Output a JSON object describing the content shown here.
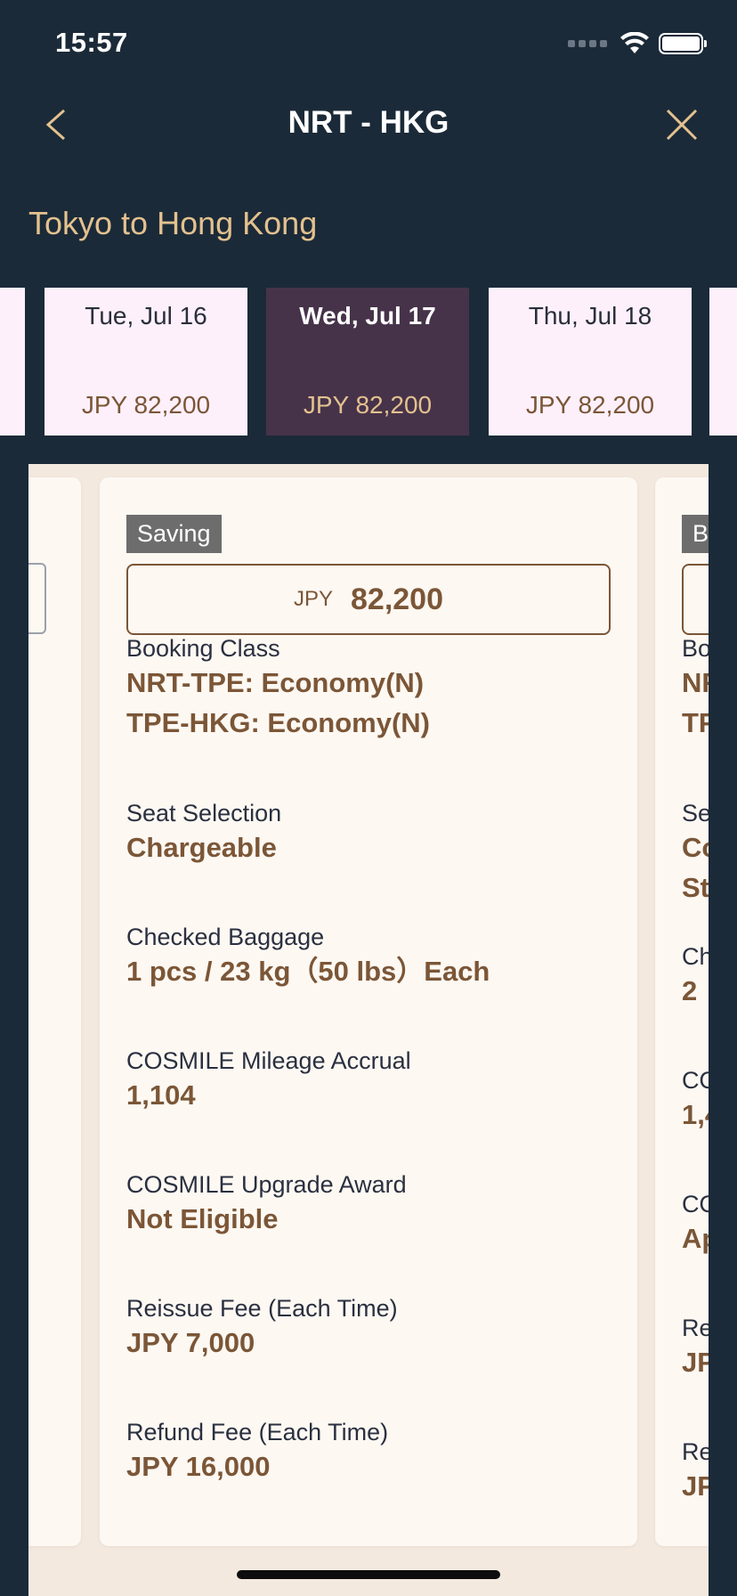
{
  "status_bar": {
    "time": "15:57"
  },
  "nav": {
    "title": "NRT - HKG"
  },
  "route_subtitle": "Tokyo to Hong Kong",
  "dates": [
    {
      "label": "Tue, Jul 16",
      "price": "JPY 82,200"
    },
    {
      "label": "Wed, Jul 17",
      "price": "JPY 82,200",
      "selected": true
    },
    {
      "label": "Thu, Jul 18",
      "price": "JPY 82,200"
    }
  ],
  "main_fare": {
    "tag": "Saving",
    "currency": "JPY",
    "amount": "82,200",
    "booking_class": {
      "label": "Booking Class",
      "line1": "NRT-TPE: Economy(N)",
      "line2": "TPE-HKG: Economy(N)"
    },
    "seat_selection": {
      "label": "Seat Selection",
      "value": "Chargeable"
    },
    "checked_baggage": {
      "label": "Checked Baggage",
      "value": "1 pcs / 23 kg（50 lbs）Each"
    },
    "mileage_accrual": {
      "label": "COSMILE Mileage Accrual",
      "value": "1,104"
    },
    "upgrade_award": {
      "label": "COSMILE Upgrade Award",
      "value": "Not Eligible"
    },
    "reissue_fee": {
      "label": "Reissue Fee (Each Time)",
      "value": "JPY 7,000"
    },
    "refund_fee": {
      "label": "Refund Fee (Each Time)",
      "value": "JPY 16,000"
    }
  },
  "right_fare_partial": {
    "tag": "B",
    "bo": "Bo",
    "nr": "NR",
    "tp": "TP",
    "se": "Se",
    "co": "Co",
    "st": "St",
    "ch": "Ch",
    "two": "2",
    "cm": "CO",
    "one4": "1,4",
    "cu": "CO",
    "ap": "Ap",
    "re": "Re",
    "jp": "JP",
    "re2": "Re",
    "jp2": "JP"
  },
  "colors": {
    "background": "#1b2a38",
    "accent_gold": "#e3c18f",
    "brown": "#7b5637",
    "selected_date": "#46334a",
    "date_card": "#fdf0fb"
  }
}
